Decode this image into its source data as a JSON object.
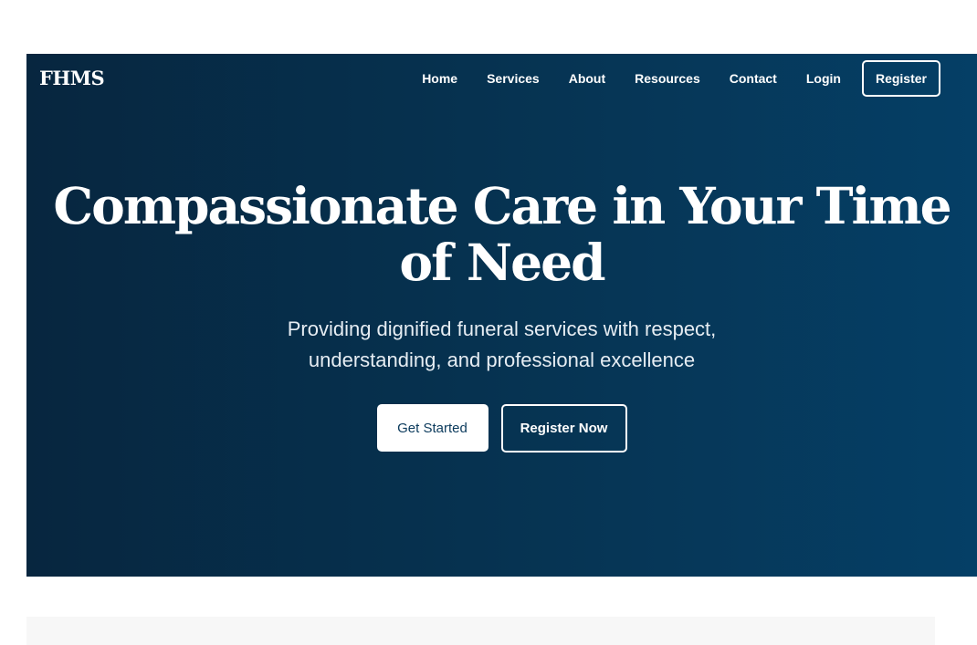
{
  "brand": {
    "logo": "FHMS"
  },
  "nav": {
    "items": [
      {
        "label": "Home"
      },
      {
        "label": "Services"
      },
      {
        "label": "About"
      },
      {
        "label": "Resources"
      },
      {
        "label": "Contact"
      },
      {
        "label": "Login"
      }
    ],
    "register_label": "Register"
  },
  "hero": {
    "title": "Compassionate Care in Your Time of Need",
    "subtitle_line1": "Providing dignified funeral services with respect,",
    "subtitle_line2": "understanding, and professional excellence",
    "primary_button": "Get Started",
    "secondary_button": "Register Now"
  },
  "colors": {
    "hero_bg_start": "#07263f",
    "hero_bg_end": "#053f66",
    "primary_button_text": "#0b3a5c",
    "page_bg": "#ffffff",
    "next_section_bg": "#f7f7f7"
  }
}
